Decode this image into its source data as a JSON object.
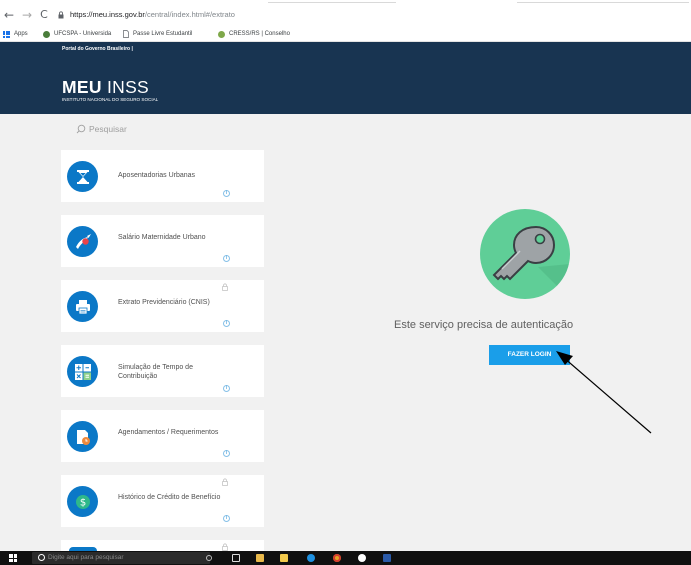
{
  "browser": {
    "url_host": "https://meu.inss.gov.br",
    "url_path": "/central/index.html#/extrato",
    "bookmarks": [
      {
        "label": "Apps",
        "icon": "apps-grid-icon"
      },
      {
        "label": "UFCSPA - Universida",
        "icon": "ufcspa-favicon-icon"
      },
      {
        "label": "Passe Livre Estudantil",
        "icon": "document-icon"
      },
      {
        "label": "CRESS/RS | Conselho",
        "icon": "cress-favicon-icon"
      }
    ]
  },
  "header": {
    "gov_bar": "Portal do Governo Brasileiro |",
    "brand_bold": "MEU",
    "brand_light": "INSS",
    "brand_sub": "INSTITUTO NACIONAL DO SEGURO SOCIAL"
  },
  "sidebar": {
    "search_placeholder": "Pesquisar",
    "services": [
      {
        "label": "Aposentadorias Urbanas",
        "icon": "hourglass-icon",
        "locked": false
      },
      {
        "label": "Salário Maternidade Urbano",
        "icon": "stork-icon",
        "locked": false
      },
      {
        "label": "Extrato Previdenciário (CNIS)",
        "icon": "printer-icon",
        "locked": true
      },
      {
        "label": "Simulação de Tempo de Contribuição",
        "icon": "calculator-icon",
        "locked": false
      },
      {
        "label": "Agendamentos / Requerimentos",
        "icon": "document-clock-icon",
        "locked": false
      },
      {
        "label": "Histórico de Crédito de Benefício",
        "icon": "dollar-icon",
        "locked": true
      }
    ],
    "info_glyph": "i"
  },
  "main": {
    "auth_message": "Este serviço precisa de autenticação",
    "login_label": "FAZER LOGIN"
  },
  "taskbar": {
    "search_placeholder": "Digite aqui para pesquisar"
  },
  "colors": {
    "header_bg": "#183451",
    "service_icon": "#0b78c7",
    "key_circle": "#5fce97",
    "login_button": "#1a9ee9",
    "page_bg": "#f1f1f1"
  }
}
